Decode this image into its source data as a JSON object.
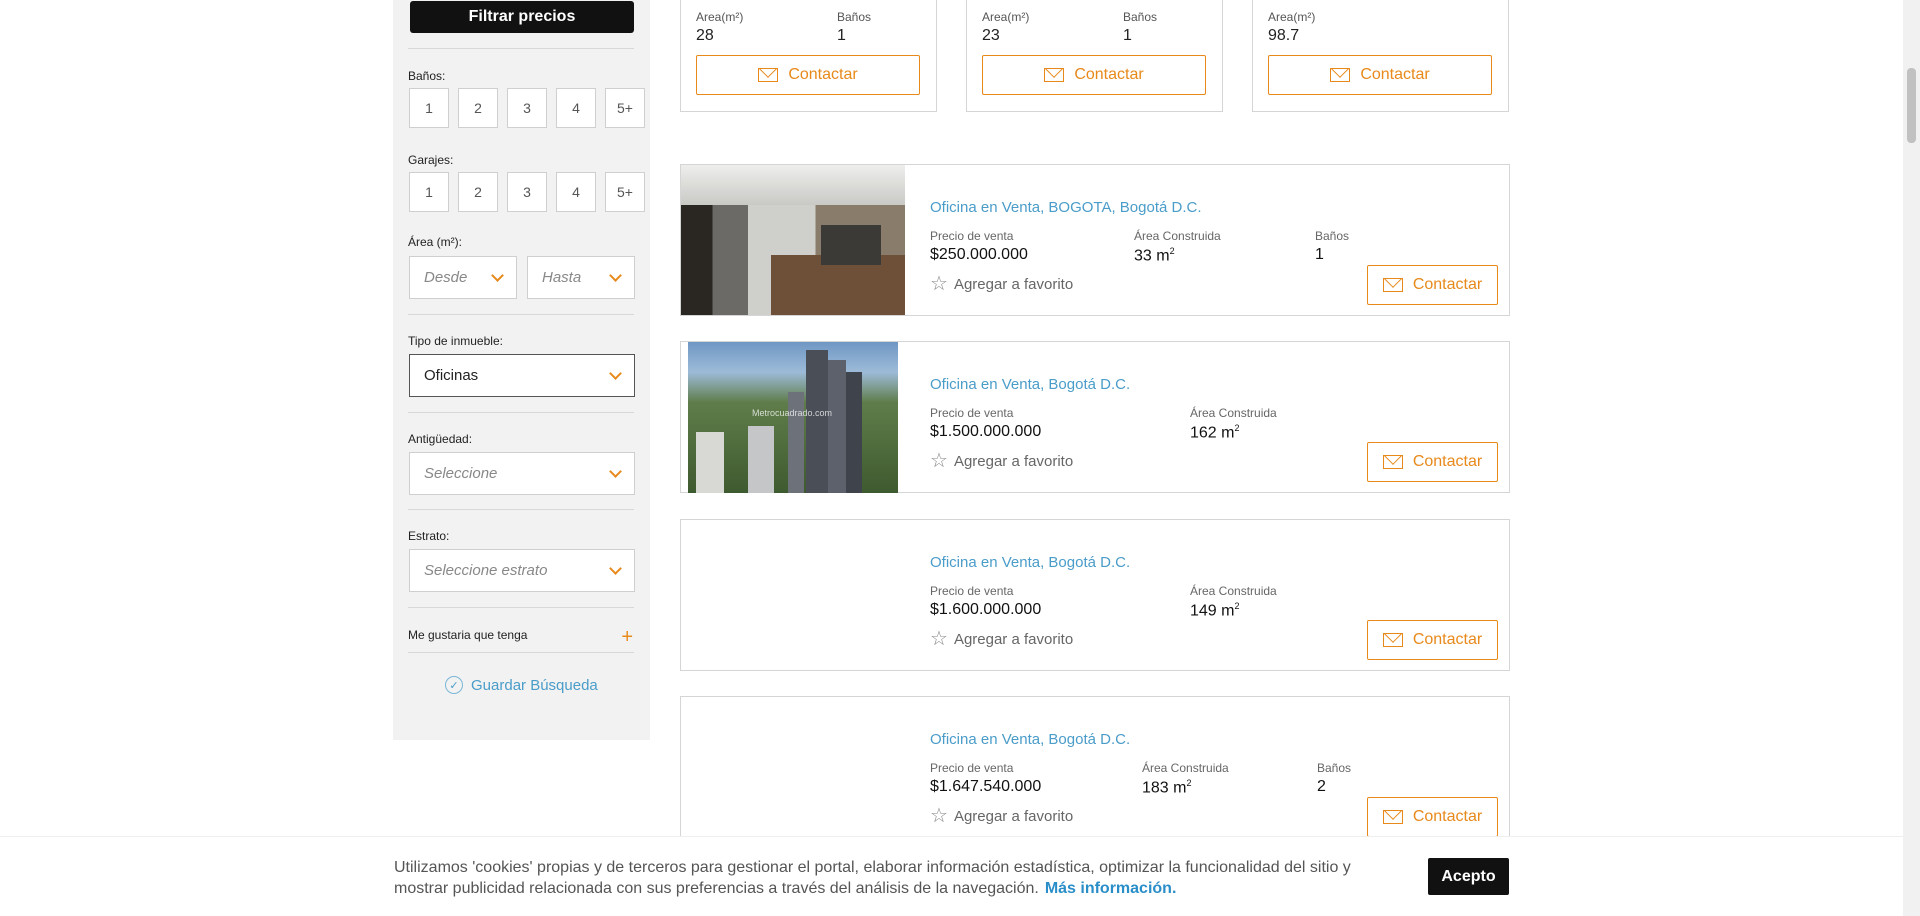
{
  "sidebar": {
    "filter_prices_label": "Filtrar precios",
    "baths_label": "Baños:",
    "baths_options": [
      "1",
      "2",
      "3",
      "4",
      "5+"
    ],
    "garages_label": "Garajes:",
    "garages_options": [
      "1",
      "2",
      "3",
      "4",
      "5+"
    ],
    "area_label": "Área (m²):",
    "area_from_placeholder": "Desde",
    "area_to_placeholder": "Hasta",
    "type_label": "Tipo de inmueble:",
    "type_value": "Oficinas",
    "age_label": "Antigüedad:",
    "age_placeholder": "Seleccione",
    "stratum_label": "Estrato:",
    "stratum_placeholder": "Seleccione estrato",
    "amenities_label": "Me gustaria que tenga",
    "save_search_label": "Guardar Búsqueda"
  },
  "top_cards": [
    {
      "area_label": "Area(m²)",
      "area_value": "28",
      "baths_label": "Baños",
      "baths_value": "1",
      "contact_label": "Contactar"
    },
    {
      "area_label": "Area(m²)",
      "area_value": "23",
      "baths_label": "Baños",
      "baths_value": "1",
      "contact_label": "Contactar"
    },
    {
      "area_label": "Area(m²)",
      "area_value": "98.7",
      "contact_label": "Contactar"
    }
  ],
  "listings": [
    {
      "title": "Oficina en Venta, BOGOTA, Bogotá D.C.",
      "price_label": "Precio de venta",
      "price": "$250.000.000",
      "area_label": "Área Construida",
      "area": "33 m",
      "baths_label": "Baños",
      "baths": "1",
      "favorite_label": "Agregar a favorito",
      "contact_label": "Contactar"
    },
    {
      "title": "Oficina en Venta, Bogotá D.C.",
      "price_label": "Precio de venta",
      "price": "$1.500.000.000",
      "area_label": "Área Construida",
      "area": "162 m",
      "favorite_label": "Agregar a favorito",
      "contact_label": "Contactar",
      "photo_watermark": "Metrocuadrado.com"
    },
    {
      "title": "Oficina en Venta, Bogotá D.C.",
      "price_label": "Precio de venta",
      "price": "$1.600.000.000",
      "area_label": "Área Construida",
      "area": "149 m",
      "favorite_label": "Agregar a favorito",
      "contact_label": "Contactar"
    },
    {
      "title": "Oficina en Venta, Bogotá D.C.",
      "price_label": "Precio de venta",
      "price": "$1.647.540.000",
      "area_label": "Área Construida",
      "area": "183 m",
      "baths_label": "Baños",
      "baths": "2",
      "favorite_label": "Agregar a favorito",
      "contact_label": "Contactar"
    }
  ],
  "cookie": {
    "text": "Utilizamos 'cookies' propias y de terceros para gestionar el portal, elaborar información estadística, optimizar la funcionalidad del sitio y mostrar publicidad relacionada con sus preferencias a través del análisis de la navegación.",
    "link": "Más información.",
    "accept": "Acepto"
  },
  "colors": {
    "accent": "#e8891b",
    "link": "#4a9cc9",
    "sidebar_bg": "#f2f2f2"
  }
}
